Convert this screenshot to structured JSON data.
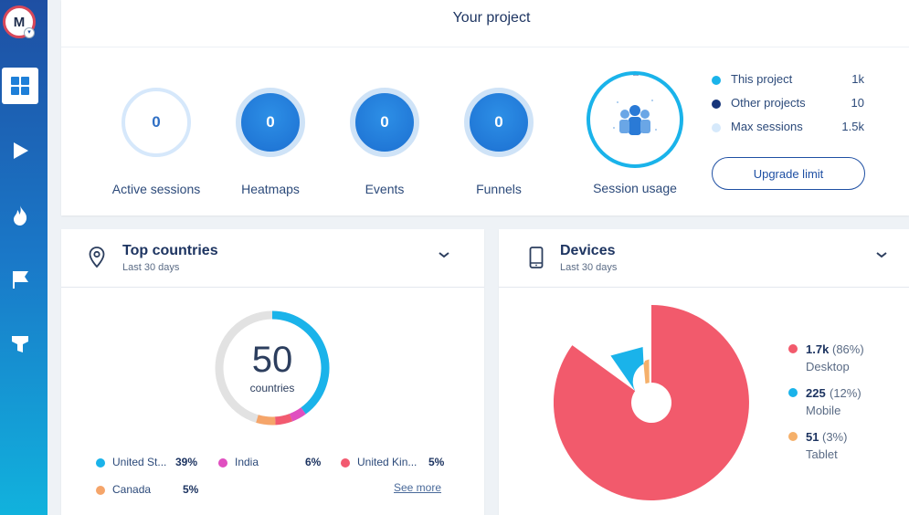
{
  "sidebar": {
    "avatar_initial": "M",
    "items": [
      {
        "name": "dashboard",
        "icon": "grid-icon"
      },
      {
        "name": "recordings",
        "icon": "play-icon"
      },
      {
        "name": "heatmaps",
        "icon": "flame-icon"
      },
      {
        "name": "events",
        "icon": "flag-icon"
      },
      {
        "name": "funnels",
        "icon": "funnel-icon"
      }
    ]
  },
  "header": {
    "title": "Your project"
  },
  "metrics": [
    {
      "value": "0",
      "label": "Active sessions"
    },
    {
      "value": "0",
      "label": "Heatmaps"
    },
    {
      "value": "0",
      "label": "Events"
    },
    {
      "value": "0",
      "label": "Funnels"
    }
  ],
  "session_usage": {
    "label": "Session usage",
    "legend": [
      {
        "name": "This project",
        "value": "1k",
        "color": "#1ab3ea"
      },
      {
        "name": "Other projects",
        "value": "10",
        "color": "#16357a"
      },
      {
        "name": "Max sessions",
        "value": "1.5k",
        "color": "#d6e9fb"
      }
    ],
    "upgrade_label": "Upgrade limit"
  },
  "top_countries": {
    "title": "Top countries",
    "subtitle": "Last 30 days",
    "total": "50",
    "total_caption": "countries",
    "countries": [
      {
        "name": "United St...",
        "pct": "39%",
        "color": "#1ab3ea"
      },
      {
        "name": "India",
        "pct": "6%",
        "color": "#e04fc0"
      },
      {
        "name": "United Kin...",
        "pct": "5%",
        "color": "#f25a70"
      },
      {
        "name": "Canada",
        "pct": "5%",
        "color": "#f5a56a"
      }
    ],
    "see_more": "See more"
  },
  "devices": {
    "title": "Devices",
    "subtitle": "Last 30 days",
    "items": [
      {
        "value": "1.7k",
        "pct": "(86%)",
        "name": "Desktop",
        "color": "#f25a6c"
      },
      {
        "value": "225",
        "pct": "(12%)",
        "name": "Mobile",
        "color": "#1ab3ea"
      },
      {
        "value": "51",
        "pct": "(3%)",
        "name": "Tablet",
        "color": "#f5b06a"
      }
    ]
  }
}
